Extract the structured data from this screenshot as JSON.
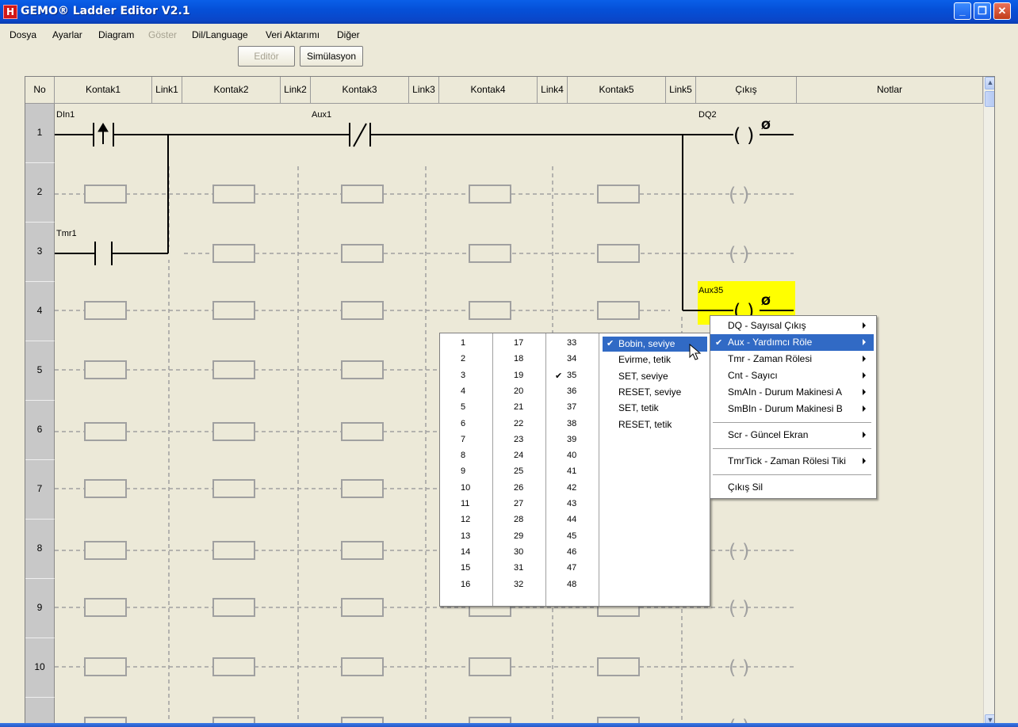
{
  "window": {
    "title": "GEMO® Ladder Editor V2.1",
    "icon_text": "H",
    "buttons": [
      "minimize",
      "restore",
      "close"
    ]
  },
  "menu": [
    "Dosya",
    "Ayarlar",
    "Diagram",
    "Göster",
    "Dil/Language",
    "Veri Aktarımı",
    "Diğer"
  ],
  "toolbar": {
    "editor_label": "Editör",
    "simulation_label": "Simülasyon"
  },
  "columns": [
    "No",
    "Kontak1",
    "Link1",
    "Kontak2",
    "Link2",
    "Kontak3",
    "Link3",
    "Kontak4",
    "Link4",
    "Kontak5",
    "Link5",
    "Çıkış",
    "Notlar"
  ],
  "rows": [
    "1",
    "2",
    "3",
    "4",
    "5",
    "6",
    "7",
    "8",
    "9",
    "10"
  ],
  "ladder": {
    "row1_contact1": "DIn1",
    "row1_contact3": "Aux1",
    "row1_output": "DQ2",
    "row3_contact1": "Tmr1",
    "row4_output": "Aux35",
    "coil_symbol": "( )",
    "coil_mark": "Ø"
  },
  "number_picker": {
    "col1": [
      "1",
      "2",
      "3",
      "4",
      "5",
      "6",
      "7",
      "8",
      "9",
      "10",
      "11",
      "12",
      "13",
      "14",
      "15",
      "16"
    ],
    "col2": [
      "17",
      "18",
      "19",
      "20",
      "21",
      "22",
      "23",
      "24",
      "25",
      "26",
      "27",
      "28",
      "29",
      "30",
      "31",
      "32"
    ],
    "col3": [
      "33",
      "34",
      "35",
      "36",
      "37",
      "38",
      "39",
      "40",
      "41",
      "42",
      "43",
      "44",
      "45",
      "46",
      "47",
      "48"
    ],
    "selected": "35",
    "check": "✔"
  },
  "coil_modes": {
    "items": [
      "Bobin, seviye",
      "Evirme, tetik",
      "SET, seviye",
      "RESET, seviye",
      "SET, tetik",
      "RESET, tetik"
    ],
    "selected": "Bobin, seviye"
  },
  "output_menu": {
    "items": [
      {
        "label": "DQ  - Sayısal Çıkış",
        "submenu": true
      },
      {
        "label": "Aux - Yardımcı Röle",
        "submenu": true,
        "checked": true,
        "highlighted": true
      },
      {
        "label": "Tmr - Zaman Rölesi",
        "submenu": true
      },
      {
        "label": "Cnt - Sayıcı",
        "submenu": true
      },
      {
        "label": "SmAIn - Durum Makinesi A",
        "submenu": true
      },
      {
        "label": "SmBIn - Durum Makinesi B",
        "submenu": true
      },
      {
        "label": "Scr - Güncel Ekran",
        "submenu": true
      },
      {
        "label": "TmrTick - Zaman Rölesi Tiki",
        "submenu": true
      },
      {
        "label": "Çıkış Sil",
        "submenu": false
      }
    ]
  },
  "colors": {
    "titlebar": "#0a5fe8",
    "highlight": "#316ac5",
    "selected_cell": "#ffff00",
    "dashed": "#a0a0a0"
  }
}
